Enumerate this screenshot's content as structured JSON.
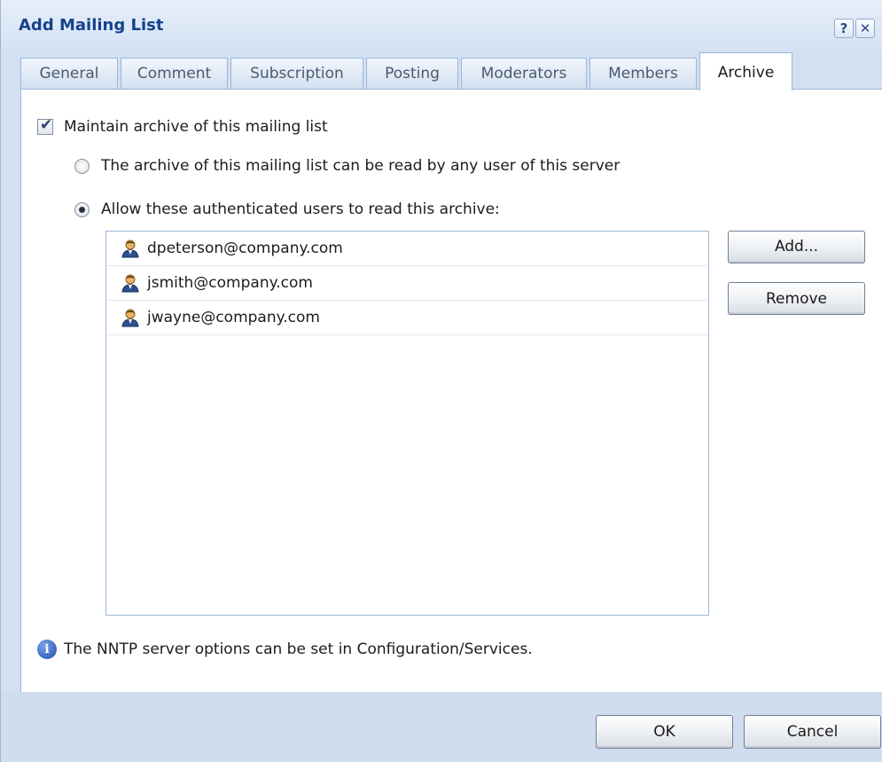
{
  "window": {
    "title": "Add Mailing List",
    "help_icon": "?",
    "close_icon": "✕"
  },
  "tabs": [
    {
      "label": "General"
    },
    {
      "label": "Comment"
    },
    {
      "label": "Subscription"
    },
    {
      "label": "Posting"
    },
    {
      "label": "Moderators"
    },
    {
      "label": "Members"
    },
    {
      "label": "Archive",
      "active": true
    }
  ],
  "archive": {
    "maintain_label": "Maintain archive of this mailing list",
    "maintain_checked": true,
    "any_user_label": "The archive of this mailing list can be read by any user of this server",
    "auth_users_label": "Allow these authenticated users to read this archive:",
    "selected_option": "auth_users",
    "users": [
      {
        "email": "dpeterson@company.com",
        "icon": "user-icon"
      },
      {
        "email": "jsmith@company.com",
        "icon": "user-icon"
      },
      {
        "email": "jwayne@company.com",
        "icon": "user-icon"
      }
    ],
    "add_button": "Add...",
    "remove_button": "Remove",
    "info_text": "The NNTP server options can be set in Configuration/Services.",
    "info_icon": "i"
  },
  "footer": {
    "ok_button": "OK",
    "cancel_button": "Cancel"
  }
}
